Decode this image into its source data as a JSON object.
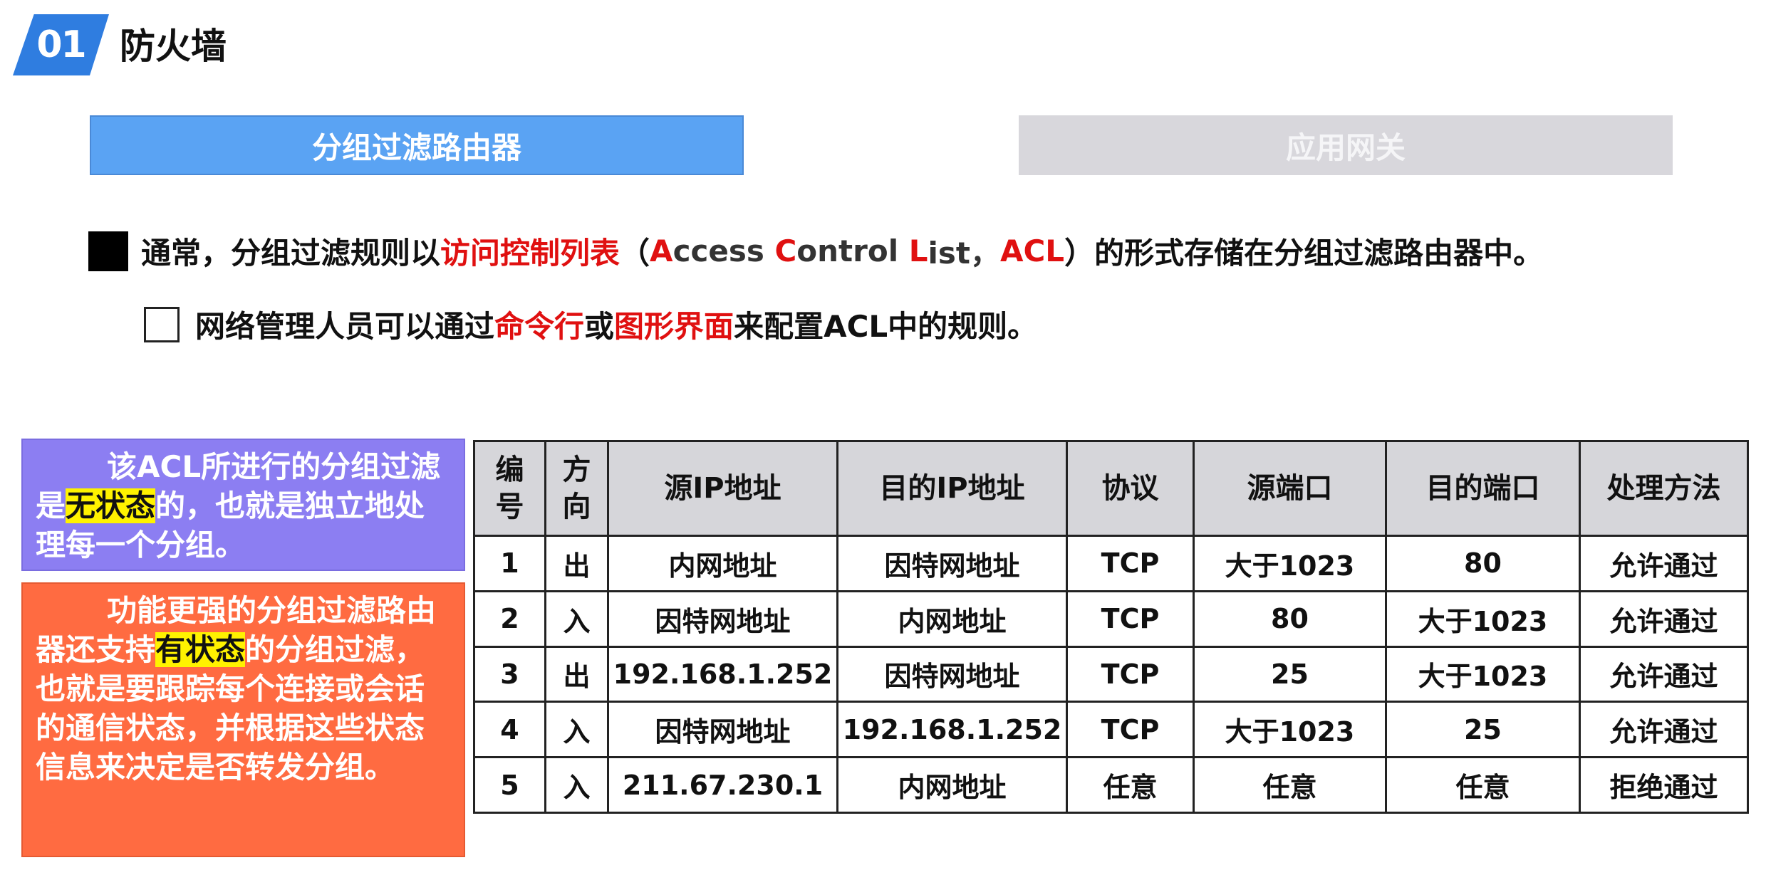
{
  "header": {
    "badge": "01",
    "title": "防火墙"
  },
  "tabs": [
    {
      "label": "分组过滤路由器",
      "active": true
    },
    {
      "label": "应用网关",
      "active": false
    }
  ],
  "bullet1": {
    "text_a": "通常，分组过滤规则以",
    "highlight": "访问控制列表",
    "text_b": "（",
    "acr_A": "A",
    "acr_A_rest": "ccess ",
    "acr_C": "C",
    "acr_C_rest": "ontrol ",
    "acr_L": "L",
    "acr_L_rest": "ist，",
    "acr_abbr": "ACL",
    "text_c": "）的形式存储在分组过滤路由器中。"
  },
  "bullet2": {
    "text_a": "网络管理人员可以通过",
    "red1": "命令行",
    "text_b": "或",
    "red2": "图形界面",
    "text_c": "来配置ACL中的规则。"
  },
  "note_stateless": {
    "text_a": "该ACL所进行的分组过滤是",
    "highlight": "无状态",
    "text_b": "的，也就是独立地处理每一个分组。"
  },
  "note_stateful": {
    "text_a": "功能更强的分组过滤路由器还支持",
    "highlight": "有状态",
    "text_b": "的分组过滤，也就是要跟踪每个连接或会话的通信状态，并根据这些状态信息来决定是否转发分组。"
  },
  "colors": {
    "accent_blue": "#2f7de0",
    "tab_active": "#5aa3f3",
    "tab_inactive": "#d8d7dc",
    "red": "#e01010",
    "note_purple": "#8c7ef2",
    "note_orange": "#ff6b41",
    "highlight": "#fff200"
  },
  "table": {
    "headers": [
      "编号",
      "方向",
      "源IP地址",
      "目的IP地址",
      "协议",
      "源端口",
      "目的端口",
      "处理方法"
    ],
    "rows": [
      [
        "1",
        "出",
        "内网地址",
        "因特网地址",
        "TCP",
        "大于1023",
        "80",
        "允许通过"
      ],
      [
        "2",
        "入",
        "因特网地址",
        "内网地址",
        "TCP",
        "80",
        "大于1023",
        "允许通过"
      ],
      [
        "3",
        "出",
        "192.168.1.252",
        "因特网地址",
        "TCP",
        "25",
        "大于1023",
        "允许通过"
      ],
      [
        "4",
        "入",
        "因特网地址",
        "192.168.1.252",
        "TCP",
        "大于1023",
        "25",
        "允许通过"
      ],
      [
        "5",
        "入",
        "211.67.230.1",
        "内网地址",
        "任意",
        "任意",
        "任意",
        "拒绝通过"
      ]
    ]
  }
}
